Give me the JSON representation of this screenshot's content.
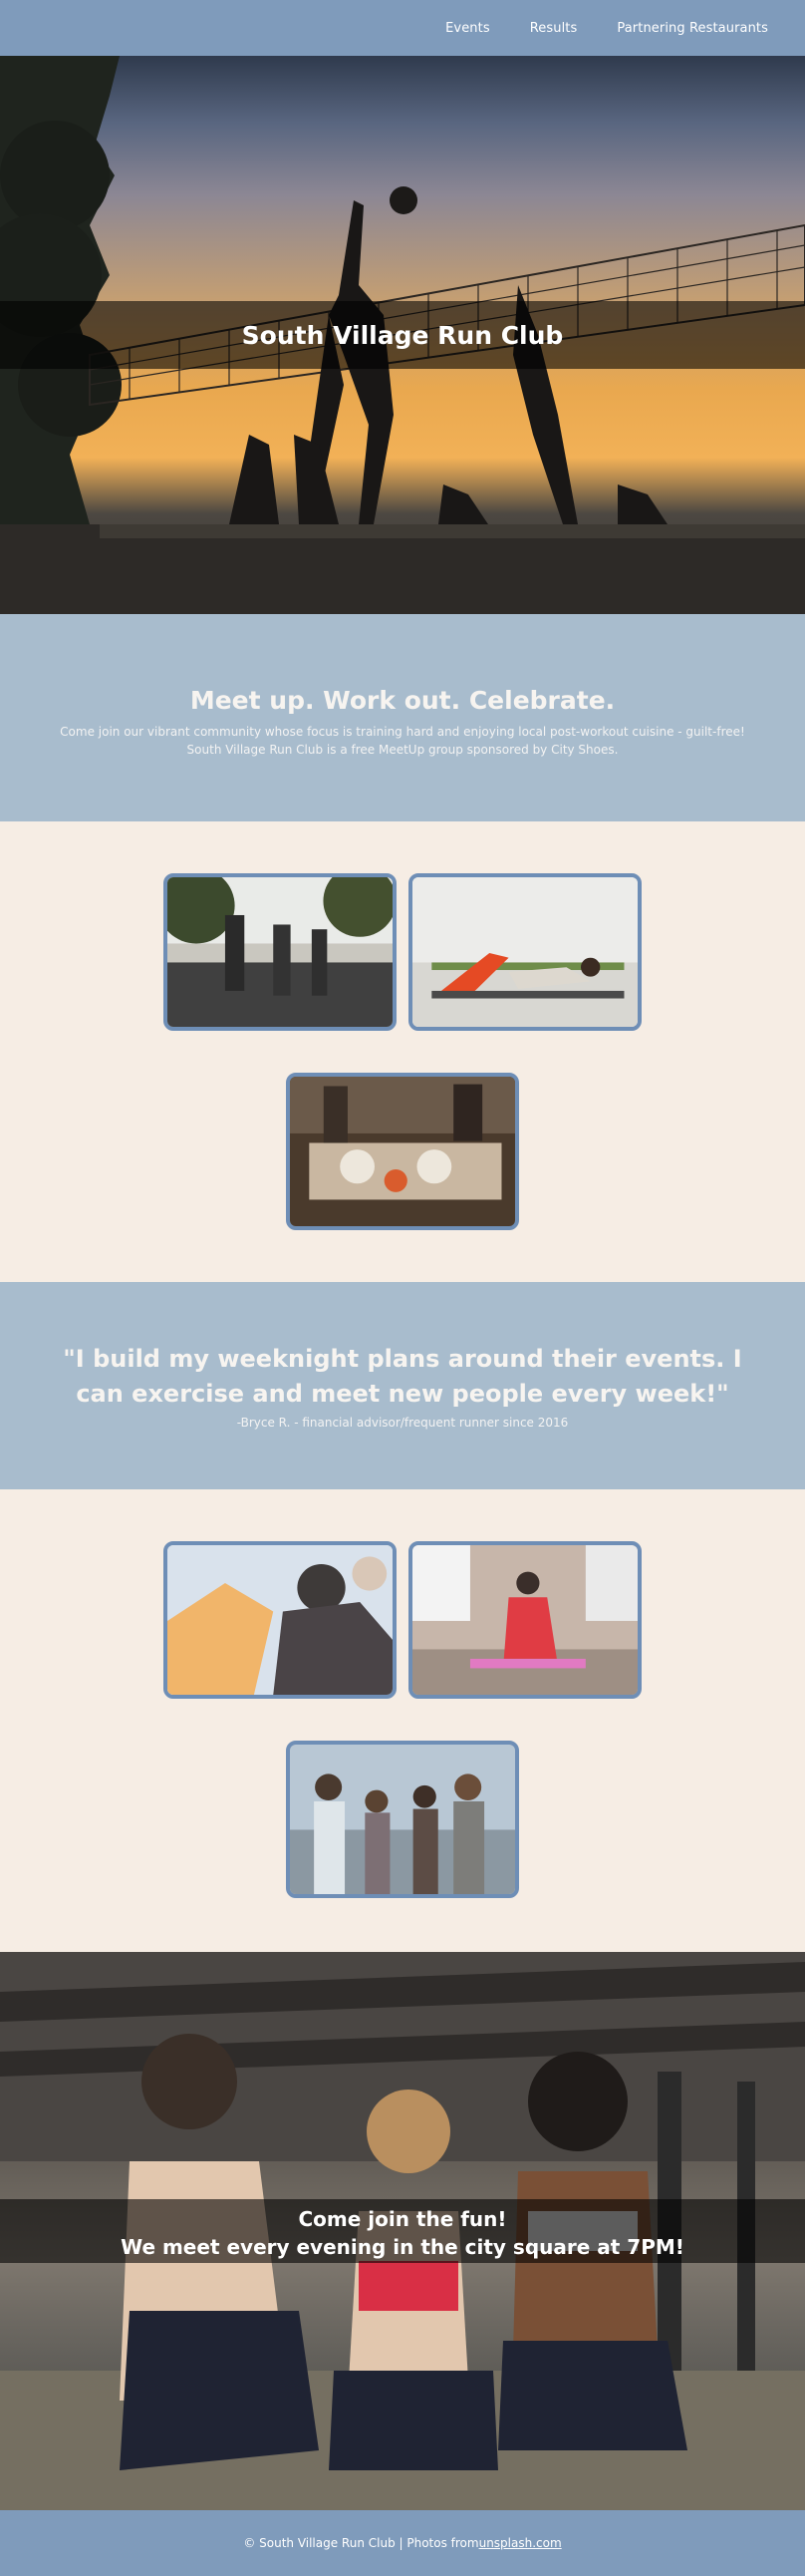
{
  "nav": {
    "items": [
      "Events",
      "Results",
      "Partnering Restaurants"
    ]
  },
  "hero": {
    "title": "South Village Run Club"
  },
  "intro": {
    "heading": "Meet up. Work out. Celebrate.",
    "line1": "Come join our vibrant community whose focus is training hard and enjoying local post-workout cuisine - guilt-free!",
    "line2": "South Village Run Club is a free MeetUp group sponsored by City Shoes."
  },
  "quote": {
    "text": "\"I build my weeknight plans around their events. I can exercise and meet new people every week!\"",
    "author": "-Bryce R. - financial advisor/frequent runner since 2016"
  },
  "cta": {
    "line1": "Come join the fun!",
    "line2": "We meet every evening in the city square at 7PM!"
  },
  "footer": {
    "prefix": "© South Village Run Club | Photos from ",
    "link": "unsplash.com"
  },
  "colors": {
    "nav": "#7f9bbb",
    "section_blue": "#a8bccd",
    "cream": "#f6ede4",
    "photo_border": "#6e8eb6"
  }
}
